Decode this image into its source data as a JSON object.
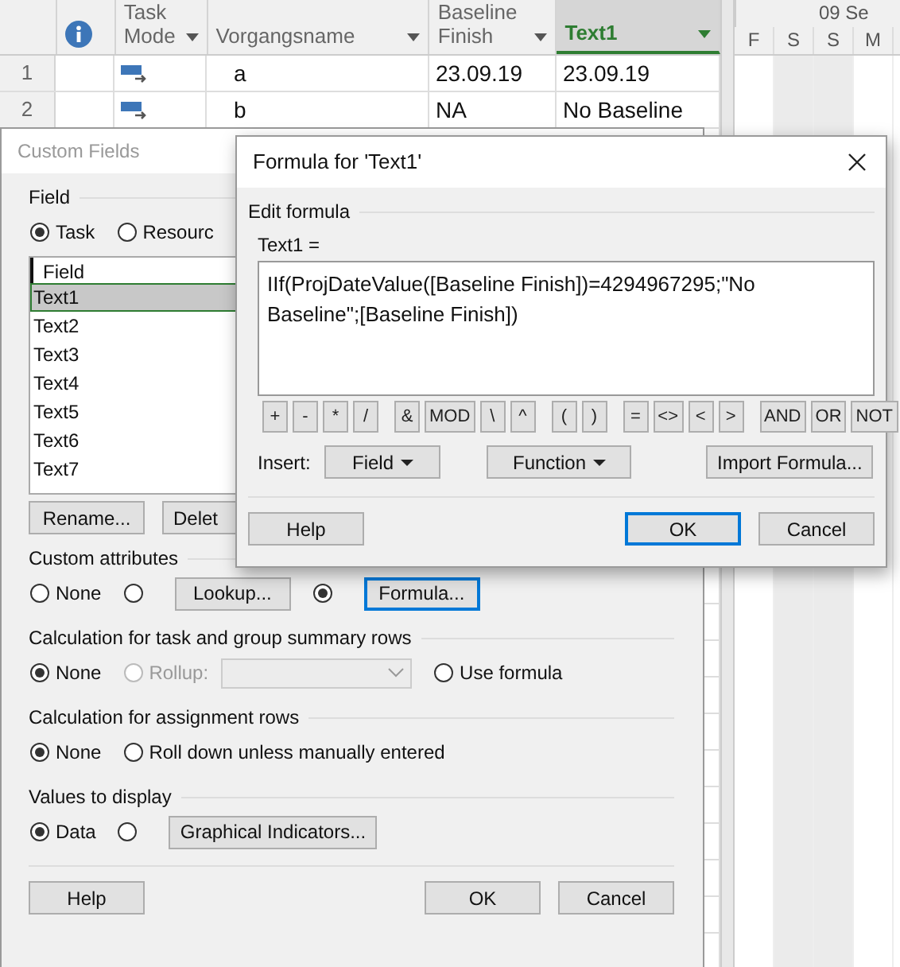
{
  "gantt": {
    "columns": [
      {
        "kind": "info",
        "selected": false
      },
      {
        "kind": "text",
        "label": "Task Mode",
        "selected": false
      },
      {
        "kind": "text",
        "label": "Vorgangsname",
        "selected": false
      },
      {
        "kind": "text",
        "label": "Baseline Finish",
        "selected": false
      },
      {
        "kind": "text",
        "label": "Text1",
        "selected": true
      }
    ],
    "rows": [
      {
        "number": "1",
        "name": "a",
        "baseline_finish": "23.09.19",
        "text1": "23.09.19"
      },
      {
        "number": "2",
        "name": "b",
        "baseline_finish": "NA",
        "text1": "No Baseline"
      }
    ],
    "timescale": {
      "top": "09 Se",
      "days": [
        {
          "label": "F",
          "weekend": false
        },
        {
          "label": "S",
          "weekend": true
        },
        {
          "label": "S",
          "weekend": true
        },
        {
          "label": "M",
          "weekend": false
        }
      ]
    }
  },
  "custom_fields": {
    "title": "Custom Fields",
    "active": false,
    "field_heading": "Field",
    "types": [
      {
        "label": "Task",
        "selected": true
      },
      {
        "label": "Resourc",
        "selected": false
      }
    ],
    "list_header": "Field",
    "items": [
      {
        "label": "Text1",
        "selected": true
      },
      {
        "label": "Text2",
        "selected": false
      },
      {
        "label": "Text3",
        "selected": false
      },
      {
        "label": "Text4",
        "selected": false
      },
      {
        "label": "Text5",
        "selected": false
      },
      {
        "label": "Text6",
        "selected": false
      },
      {
        "label": "Text7",
        "selected": false
      }
    ],
    "list_buttons": [
      "Rename...",
      "Delet"
    ],
    "sections": [
      {
        "heading": "Custom attributes",
        "options": [
          {
            "kind": "radio",
            "label": "None",
            "selected": false
          },
          {
            "kind": "radio",
            "selected": false
          },
          {
            "kind": "button",
            "label": "Lookup...",
            "focused": false
          },
          {
            "kind": "radio",
            "selected": true
          },
          {
            "kind": "button",
            "label": "Formula...",
            "focused": true
          }
        ]
      },
      {
        "heading": "Calculation for task and group summary rows",
        "options": [
          {
            "kind": "radio",
            "label": "None",
            "selected": true,
            "disabled": false
          },
          {
            "kind": "radio",
            "label": "Rollup:",
            "selected": false,
            "disabled": true
          },
          {
            "kind": "combo",
            "disabled": true
          },
          {
            "kind": "radio",
            "label": "Use formula",
            "selected": false,
            "disabled": false
          }
        ]
      },
      {
        "heading": "Calculation for assignment rows",
        "options": [
          {
            "kind": "radio",
            "label": "None",
            "selected": true
          },
          {
            "kind": "radio",
            "label": "Roll down unless manually entered",
            "selected": false
          }
        ]
      },
      {
        "heading": "Values to display",
        "options": [
          {
            "kind": "radio",
            "label": "Data",
            "selected": true
          },
          {
            "kind": "radio",
            "selected": false
          },
          {
            "kind": "button",
            "label": "Graphical Indicators...",
            "focused": false
          }
        ]
      }
    ],
    "buttons": [
      {
        "label": "Help",
        "focused": false
      },
      {
        "label": "OK",
        "focused": false
      },
      {
        "label": "Cancel",
        "focused": false
      }
    ]
  },
  "formula_dialog": {
    "title": "Formula for 'Text1'",
    "active": true,
    "heading": "Edit formula",
    "field_label": "Text1 =",
    "formula": "IIf(ProjDateValue([Baseline Finish])=4294967295;\"No Baseline\";[Baseline Finish])",
    "operator_groups": [
      [
        "+",
        "-",
        "*",
        "/"
      ],
      [
        "&",
        "MOD",
        "\\",
        "^"
      ],
      [
        "(",
        ")"
      ],
      [
        "=",
        "<>",
        "<",
        ">"
      ],
      [
        "AND",
        "OR",
        "NOT"
      ]
    ],
    "insert_label": "Insert:",
    "insert_buttons": [
      {
        "label": "Field",
        "menu": true
      },
      {
        "label": "Function",
        "menu": true
      },
      {
        "label": "Import Formula...",
        "menu": false
      }
    ],
    "buttons": [
      {
        "label": "Help",
        "focused": false
      },
      {
        "label": "OK",
        "focused": true
      },
      {
        "label": "Cancel",
        "focused": false
      }
    ]
  }
}
